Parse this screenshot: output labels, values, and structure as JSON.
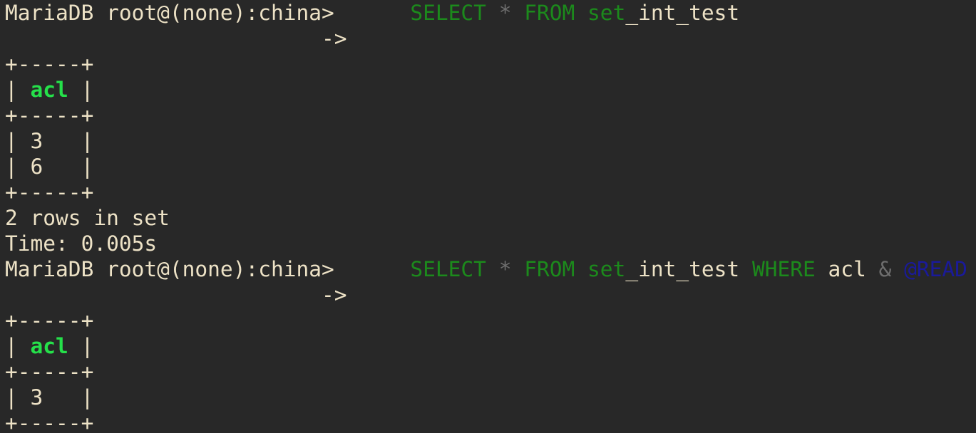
{
  "window": {
    "title": ""
  },
  "theme": {
    "background": "#282828",
    "foreground": "#ede2c6",
    "keyword": "#1c8a1c",
    "operator": "#6e6e6e",
    "variable": "#1a1a9a",
    "column_header": "#25e04a"
  },
  "session": [
    {
      "prompt": "MariaDB root@(none):china>",
      "query": {
        "select": "SELECT",
        "star": "*",
        "from": "FROM",
        "set_kw": "set",
        "table_rest": "_int_test",
        "where": "",
        "col": "",
        "amp": "",
        "var": ""
      },
      "continuation": "->",
      "result": {
        "border": "+-----+",
        "header": "acl",
        "rows": [
          "3",
          "6"
        ]
      },
      "footer": {
        "rows_text": "2 rows in set",
        "time_text": "Time: 0.005s"
      }
    },
    {
      "prompt": "MariaDB root@(none):china>",
      "query": {
        "select": "SELECT",
        "star": "*",
        "from": "FROM",
        "set_kw": "set",
        "table_rest": "_int_test",
        "where": "WHERE",
        "col": "acl",
        "amp": "&",
        "var": "@READ"
      },
      "continuation": "->",
      "result": {
        "border": "+-----+",
        "header": "acl",
        "rows": [
          "3"
        ]
      }
    }
  ]
}
